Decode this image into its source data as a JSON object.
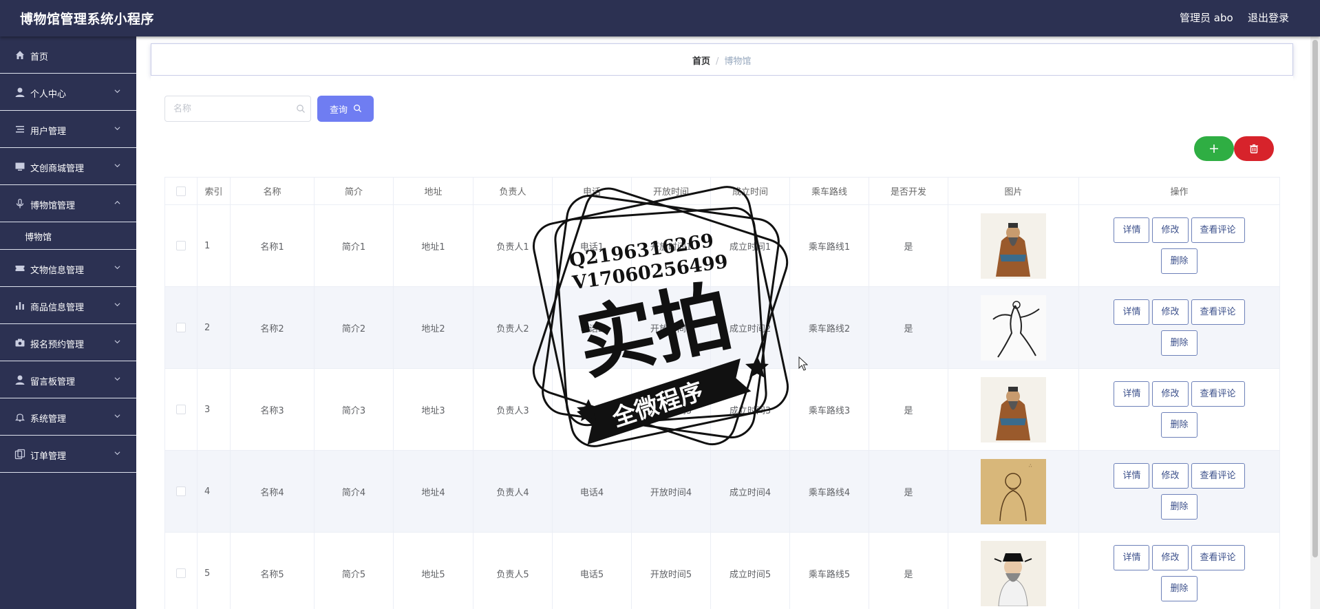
{
  "app": {
    "title": "博物馆管理系统小程序",
    "user": "管理员 abo",
    "logout": "退出登录"
  },
  "sidebar": {
    "items": [
      {
        "label": "首页",
        "icon": "home-icon",
        "expandable": false
      },
      {
        "label": "个人中心",
        "icon": "user-icon",
        "expandable": true
      },
      {
        "label": "用户管理",
        "icon": "list-icon",
        "expandable": true
      },
      {
        "label": "文创商城管理",
        "icon": "monitor-icon",
        "expandable": true
      },
      {
        "label": "博物馆管理",
        "icon": "microphone-icon",
        "expandable": true,
        "expanded": true,
        "children": [
          "博物馆"
        ]
      },
      {
        "label": "文物信息管理",
        "icon": "ticket-icon",
        "expandable": true
      },
      {
        "label": "商品信息管理",
        "icon": "bar-chart-icon",
        "expandable": true
      },
      {
        "label": "报名预约管理",
        "icon": "camera-icon",
        "expandable": true
      },
      {
        "label": "留言板管理",
        "icon": "person-icon",
        "expandable": true
      },
      {
        "label": "系统管理",
        "icon": "bell-icon",
        "expandable": true
      },
      {
        "label": "订单管理",
        "icon": "copy-icon",
        "expandable": true
      }
    ]
  },
  "breadcrumb": {
    "home": "首页",
    "sep": "/",
    "current": "博物馆"
  },
  "search": {
    "placeholder": "名称",
    "button": "查询"
  },
  "table": {
    "columns": [
      "索引",
      "名称",
      "简介",
      "地址",
      "负责人",
      "电话",
      "开放时间",
      "成立时间",
      "乘车路线",
      "是否开发",
      "图片",
      "操作"
    ],
    "rows": [
      {
        "index": "1",
        "name": "名称1",
        "intro": "简介1",
        "address": "地址1",
        "manager": "负责人1",
        "phone": "电话1",
        "open": "开放时间1",
        "founded": "成立时间1",
        "route": "乘车路线1",
        "dev": "是",
        "picture": "portrait-confucius"
      },
      {
        "index": "2",
        "name": "名称2",
        "intro": "简介2",
        "address": "地址2",
        "manager": "负责人2",
        "phone": "电话2",
        "open": "开放时间2",
        "founded": "成立时间2",
        "route": "乘车路线2",
        "dev": "是",
        "picture": "portrait-ink-figure"
      },
      {
        "index": "3",
        "name": "名称3",
        "intro": "简介3",
        "address": "地址3",
        "manager": "负责人3",
        "phone": "电话3",
        "open": "开放时间3",
        "founded": "成立时间3",
        "route": "乘车路线3",
        "dev": "是",
        "picture": "portrait-confucius"
      },
      {
        "index": "4",
        "name": "名称4",
        "intro": "简介4",
        "address": "地址4",
        "manager": "负责人4",
        "phone": "电话4",
        "open": "开放时间4",
        "founded": "成立时间4",
        "route": "乘车路线4",
        "dev": "是",
        "picture": "portrait-scholar-sketch"
      },
      {
        "index": "5",
        "name": "名称5",
        "intro": "简介5",
        "address": "地址5",
        "manager": "负责人5",
        "phone": "电话5",
        "open": "开放时间5",
        "founded": "成立时间5",
        "route": "乘车路线5",
        "dev": "是",
        "picture": "portrait-poet"
      }
    ],
    "actions": {
      "detail": "详情",
      "edit": "修改",
      "comments": "查看评论",
      "delete": "删除"
    }
  },
  "watermark": {
    "line1": "Q2196316269",
    "line2": "V17060256499",
    "main": "实拍",
    "banner": "全微程序"
  },
  "colors": {
    "sidebar": "#2c3152",
    "primary": "#6f7df2",
    "add": "#2fae43",
    "danger": "#d7232b",
    "row_alt": "#f3f5fa"
  }
}
